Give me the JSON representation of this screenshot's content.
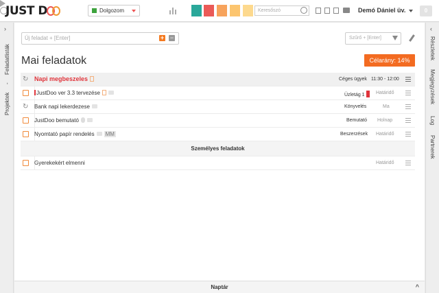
{
  "app": {
    "logo_left": "JUST D",
    "user_name": "Demó Dániel üv.",
    "counter": "0"
  },
  "toolbar": {
    "status_label": "Dolgozom",
    "search_placeholder": "Keresőszó",
    "swatches": [
      "#2aa89a",
      "#ea5a57",
      "#f7a35c",
      "#fcc56f",
      "#fdd98e"
    ]
  },
  "main": {
    "new_task_placeholder": "Új feladat + [Enter]",
    "filter_placeholder": "Szűrő + [Enter]",
    "title": "Mai feladatok",
    "goal_label": "Célarány: 14%"
  },
  "tasks": [
    {
      "name": "Napi megbeszeles",
      "tag": "Céges ügyek",
      "due": "11:30 - 12:00"
    },
    {
      "name": "JustDoo ver 3.3 tervezése",
      "tag": "Üzletág 1",
      "due": "Határidő"
    },
    {
      "name": "Bank napi lekerdezese",
      "tag": "Könyvelés",
      "due": "Ma"
    },
    {
      "name": "JustDoo bemutató",
      "tag": "Bemutató",
      "due": "Holnap"
    },
    {
      "name": "Nyomtató papír rendelés",
      "badge": "MM",
      "tag": "Beszerzések",
      "due": "Határidő"
    }
  ],
  "personal": {
    "section_title": "Személyes feladatok",
    "tasks": [
      {
        "name": "Gyerekekért elmenni",
        "due": "Határidő"
      }
    ]
  },
  "left_rail": {
    "feladatlistak": "Feladatlisták",
    "separator": "-",
    "projektek": "Projektek"
  },
  "right_rail": {
    "reszletek": "Részletek",
    "megjegyzesek": "Megjegyzések",
    "log": "Log",
    "partnerek": "Partnerek"
  },
  "bottom": {
    "naptar": "Naptár"
  }
}
